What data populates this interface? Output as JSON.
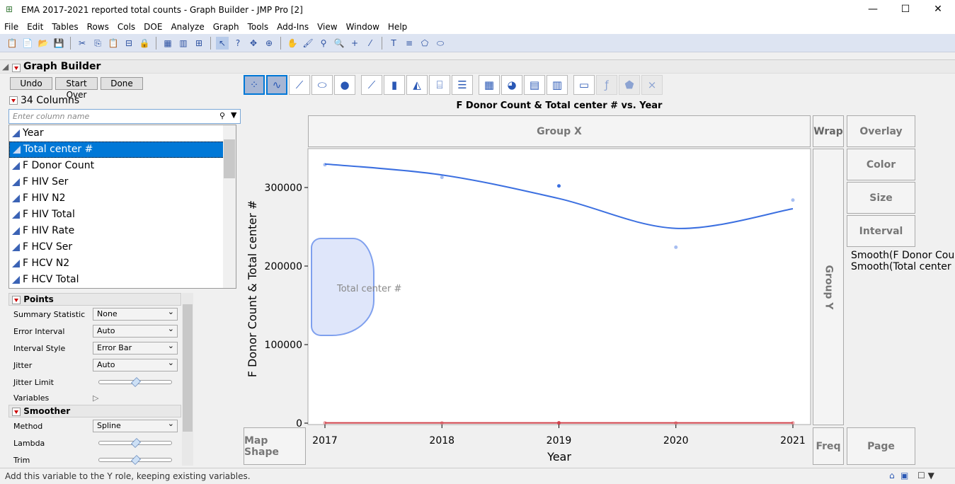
{
  "window": {
    "title": "EMA 2017-2021 reported total counts - Graph Builder - JMP Pro [2]",
    "min": "—",
    "max": "☐",
    "close": "✕"
  },
  "menu": [
    "File",
    "Edit",
    "Tables",
    "Rows",
    "Cols",
    "DOE",
    "Analyze",
    "Graph",
    "Tools",
    "Add-Ins",
    "View",
    "Window",
    "Help"
  ],
  "toolbar_icons": [
    "📋",
    "📄",
    "📂",
    "💾",
    "✂",
    "⎘",
    "📋",
    "⊟",
    "🔒",
    "▦",
    "▥",
    "⊞",
    "↖",
    "?",
    "✥",
    "⊕",
    "✋",
    "🖌",
    "⚲",
    "🔍",
    "+",
    "⁄",
    "T",
    "≡",
    "⬠",
    "⬭"
  ],
  "graph_builder": {
    "title": "Graph Builder",
    "undo": "Undo",
    "start_over": "Start Over",
    "done": "Done",
    "columns_count": "34 Columns",
    "search_placeholder": "Enter column name"
  },
  "columns": [
    "Year",
    "Total center #",
    "F Donor Count",
    "F HIV Ser",
    "F HIV N2",
    "F HIV Total",
    "F HIV Rate",
    "F HCV Ser",
    "F HCV N2",
    "F HCV Total"
  ],
  "selected_column": "Total center #",
  "element_icons": [
    "⁘",
    "∿",
    "⟋",
    "⬭",
    "●",
    "⟋",
    "▮",
    "◭",
    "⌸",
    "☰",
    "▦",
    "◕",
    "▤",
    "▥",
    "▭",
    "ƒ",
    "⬟",
    "⨯"
  ],
  "points": {
    "title": "Points",
    "rows": [
      {
        "label": "Summary Statistic",
        "value": "None"
      },
      {
        "label": "Error Interval",
        "value": "Auto"
      },
      {
        "label": "Interval Style",
        "value": "Error Bar"
      },
      {
        "label": "Jitter",
        "value": "Auto"
      }
    ],
    "jitter_limit": "Jitter Limit",
    "variables": "Variables"
  },
  "smoother": {
    "title": "Smoother",
    "method_label": "Method",
    "method": "Spline",
    "lambda": "Lambda",
    "trim": "Trim"
  },
  "zones": {
    "group_x": "Group X",
    "wrap": "Wrap",
    "overlay": "Overlay",
    "color": "Color",
    "size": "Size",
    "interval": "Interval",
    "group_y": "Group Y",
    "map_shape": "Map Shape",
    "freq": "Freq",
    "page": "Page"
  },
  "drag_label": "Total center #",
  "legend": [
    "Smooth(F Donor Count)",
    "Smooth(Total center #)"
  ],
  "status": "Add this variable to the Y role, keeping existing variables.",
  "chart_data": {
    "type": "line",
    "title": "F Donor Count & Total center # vs. Year",
    "xlabel": "Year",
    "ylabel": "F Donor Count & Total center #",
    "x": [
      2017,
      2018,
      2019,
      2020,
      2021
    ],
    "ylim": [
      0,
      340000
    ],
    "yticks": [
      0,
      100000,
      200000,
      300000
    ],
    "ytick_labels": [
      "0",
      "100000",
      "200000",
      "300000"
    ],
    "series": [
      {
        "name": "F Donor Count",
        "color": "#3b6fe0",
        "points": [
          329000,
          313000,
          302000,
          224000,
          284000
        ],
        "smooth": [
          330000,
          316000,
          286000,
          248000,
          273000
        ]
      },
      {
        "name": "Total center #",
        "color": "#d0404a",
        "points": [
          300,
          300,
          320,
          280,
          300
        ],
        "smooth": [
          300,
          300,
          310,
          290,
          300
        ]
      }
    ]
  }
}
